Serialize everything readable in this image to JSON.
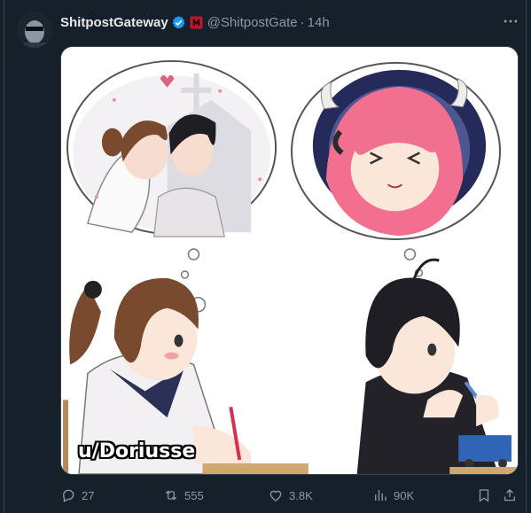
{
  "post": {
    "display_name": "ShitpostGateway",
    "handle": "@ShitpostGate",
    "separator": "·",
    "time": "14h",
    "more_label": "···"
  },
  "media": {
    "watermark": "u/Doriusse"
  },
  "actions": {
    "replies": "27",
    "reposts": "555",
    "likes": "3.8K",
    "views": "90K"
  },
  "colors": {
    "background": "#15202b",
    "text": "#e7e9ea",
    "muted": "#8b98a5",
    "verified": "#1d9bf0",
    "affiliate": "#e0245e"
  },
  "icons": [
    "avatar",
    "verified-badge-icon",
    "affiliate-badge-icon",
    "more-icon",
    "reply-icon",
    "repost-icon",
    "like-icon",
    "views-icon",
    "bookmark-icon",
    "share-icon"
  ]
}
